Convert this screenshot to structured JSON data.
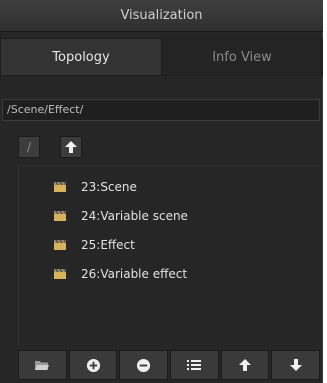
{
  "window": {
    "title": "Visualization"
  },
  "tabs": [
    {
      "label": "Topology",
      "active": true
    },
    {
      "label": "Info View",
      "active": false
    }
  ],
  "path": {
    "value": "/Scene/Effect/"
  },
  "nav": {
    "root_label": "/",
    "up_icon": "arrow-up-icon"
  },
  "tree": {
    "items": [
      {
        "label": "23:Scene",
        "icon": "clapperboard-icon"
      },
      {
        "label": "24:Variable scene",
        "icon": "clapperboard-icon"
      },
      {
        "label": "25:Effect",
        "icon": "clapperboard-icon"
      },
      {
        "label": "26:Variable effect",
        "icon": "clapperboard-icon"
      }
    ]
  },
  "toolbar": {
    "buttons": [
      {
        "icon": "open-folder-icon"
      },
      {
        "icon": "add-circle-icon"
      },
      {
        "icon": "remove-circle-icon"
      },
      {
        "icon": "list-icon"
      },
      {
        "icon": "arrow-up-icon"
      },
      {
        "icon": "arrow-down-icon"
      }
    ]
  },
  "colors": {
    "panel_bg": "#262626",
    "text": "#e2e2e2",
    "icon_gold": "#d8b25a"
  }
}
